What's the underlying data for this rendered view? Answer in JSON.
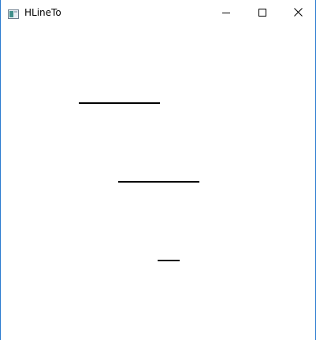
{
  "window": {
    "title": "HLineTo",
    "icon": "app-window-icon",
    "controls": {
      "minimize_icon": "minimize-icon",
      "maximize_icon": "maximize-icon",
      "close_icon": "close-icon"
    }
  },
  "canvas": {
    "lines": [
      "line",
      "line",
      "line"
    ],
    "line_color": "#000000"
  }
}
